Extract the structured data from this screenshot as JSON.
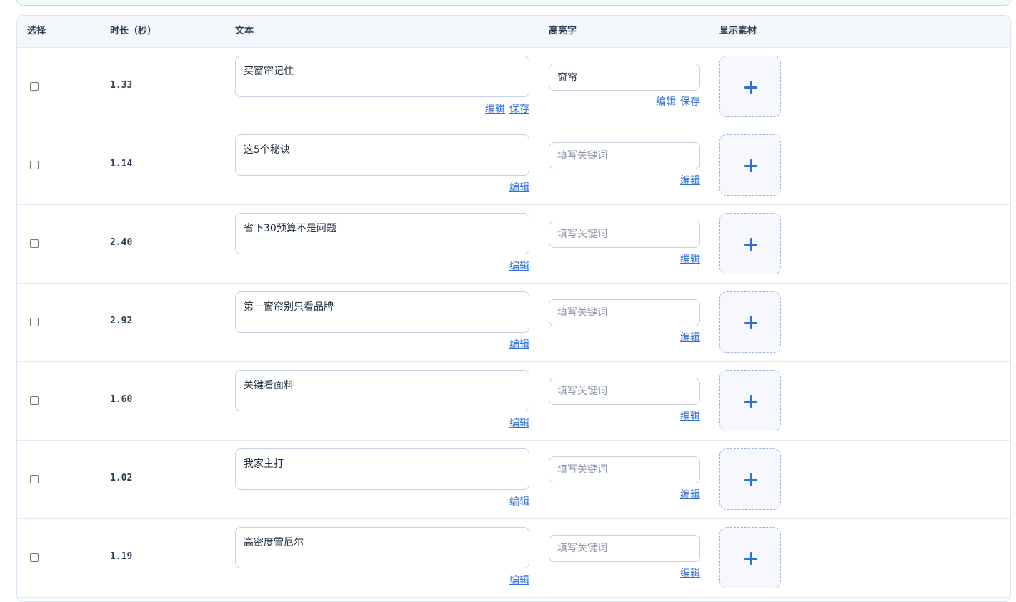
{
  "table": {
    "headers": {
      "select": "选择",
      "duration": "时长（秒）",
      "text": "文本",
      "highlight": "高亮字",
      "media": "显示素材"
    },
    "edit_label": "编辑",
    "save_label": "保存",
    "keyword_placeholder": "填写关键词",
    "rows": [
      {
        "duration": "1.33",
        "text": "买窗帘记住",
        "highlight": "窗帘"
      },
      {
        "duration": "1.14",
        "text": "这5个秘诀",
        "highlight": ""
      },
      {
        "duration": "2.40",
        "text": "省下30预算不是问题",
        "highlight": ""
      },
      {
        "duration": "2.92",
        "text": "第一窗帘别只看品牌",
        "highlight": ""
      },
      {
        "duration": "1.60",
        "text": "关键看面料",
        "highlight": ""
      },
      {
        "duration": "1.02",
        "text": "我家主打",
        "highlight": ""
      },
      {
        "duration": "1.19",
        "text": "高密度雪尼尔",
        "highlight": ""
      }
    ]
  },
  "icons": {
    "upload": "plus-icon"
  },
  "colors": {
    "accent": "#2f6fd6",
    "header_bg": "#f4f7fc",
    "border": "#c6d2e2"
  }
}
